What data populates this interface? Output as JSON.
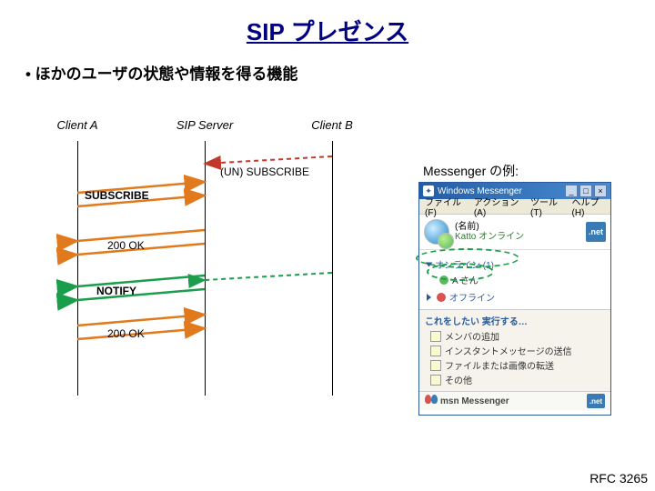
{
  "title": "SIP プレゼンス",
  "bullet": "• ほかのユーザの状態や情報を得る機能",
  "nodes": {
    "clientA": "Client A",
    "sipServer": "SIP Server",
    "clientB": "Client B"
  },
  "messages": {
    "subscribe": "SUBSCRIBE",
    "unsubscribe": "(UN) SUBSCRIBE",
    "ok1": "200 OK",
    "notify": "NOTIFY",
    "ok2": "200 OK"
  },
  "example_label": "Messenger の例:",
  "rfc": "RFC 3265",
  "msn": {
    "title": "Windows Messenger",
    "menu": {
      "file": "ファイル(F)",
      "action": "アクション(A)",
      "tools": "ツール(T)",
      "help": "ヘルプ(H)"
    },
    "user_name": "(名前)",
    "user_status": "Katto オンライン",
    "net_badge": ".net",
    "group_online": "オンライン (1)",
    "contact_name": "A さん",
    "group_offline": "オフライン",
    "actions_title": "これをしたい 実行する…",
    "actions": {
      "add_contact": "メンバの追加",
      "send_im": "インスタントメッセージの送信",
      "send_file": "ファイルまたは画像の転送",
      "other": "その他"
    },
    "footer_brand": "msn  Messenger",
    "footer_badge": ".net"
  },
  "colors": {
    "sub_arrow": "#e07a1d",
    "notify_arrow": "#1b9e4b",
    "dashed_red": "#c0392b",
    "dashed_green": "#1b9e4b"
  }
}
